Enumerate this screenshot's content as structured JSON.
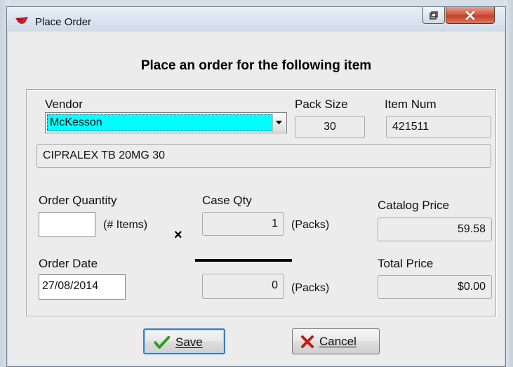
{
  "window": {
    "title": "Place Order"
  },
  "heading": "Place an order for the following item",
  "vendor": {
    "label": "Vendor",
    "selected": "McKesson"
  },
  "pack_size": {
    "label": "Pack Size",
    "value": "30"
  },
  "item_num": {
    "label": "Item Num",
    "value": "421511"
  },
  "description": "CIPRALEX TB 20MG 30",
  "order_quantity": {
    "label": "Order Quantity",
    "value": "",
    "unit": "(# Items)"
  },
  "multiply_symbol": "×",
  "case_qty": {
    "label": "Case Qty",
    "value": "1",
    "unit": "(Packs)"
  },
  "catalog_price": {
    "label": "Catalog Price",
    "value": "59.58"
  },
  "order_date": {
    "label": "Order Date",
    "value": "27/08/2014"
  },
  "total_packs": {
    "value": "0",
    "unit": "(Packs)"
  },
  "total_price": {
    "label": "Total Price",
    "value": "$0.00"
  },
  "buttons": {
    "save": "Save",
    "cancel": "Cancel"
  },
  "colors": {
    "selection_highlight": "#00ffff",
    "save_check": "#2e9e1f",
    "cancel_x": "#c21c1c",
    "close_button": "#c9452d"
  },
  "icons": {
    "app": "red-bowl-icon",
    "restore": "restore-icon",
    "close": "close-icon",
    "dropdown": "chevron-down-icon",
    "save": "checkmark-icon",
    "cancel": "x-icon"
  }
}
